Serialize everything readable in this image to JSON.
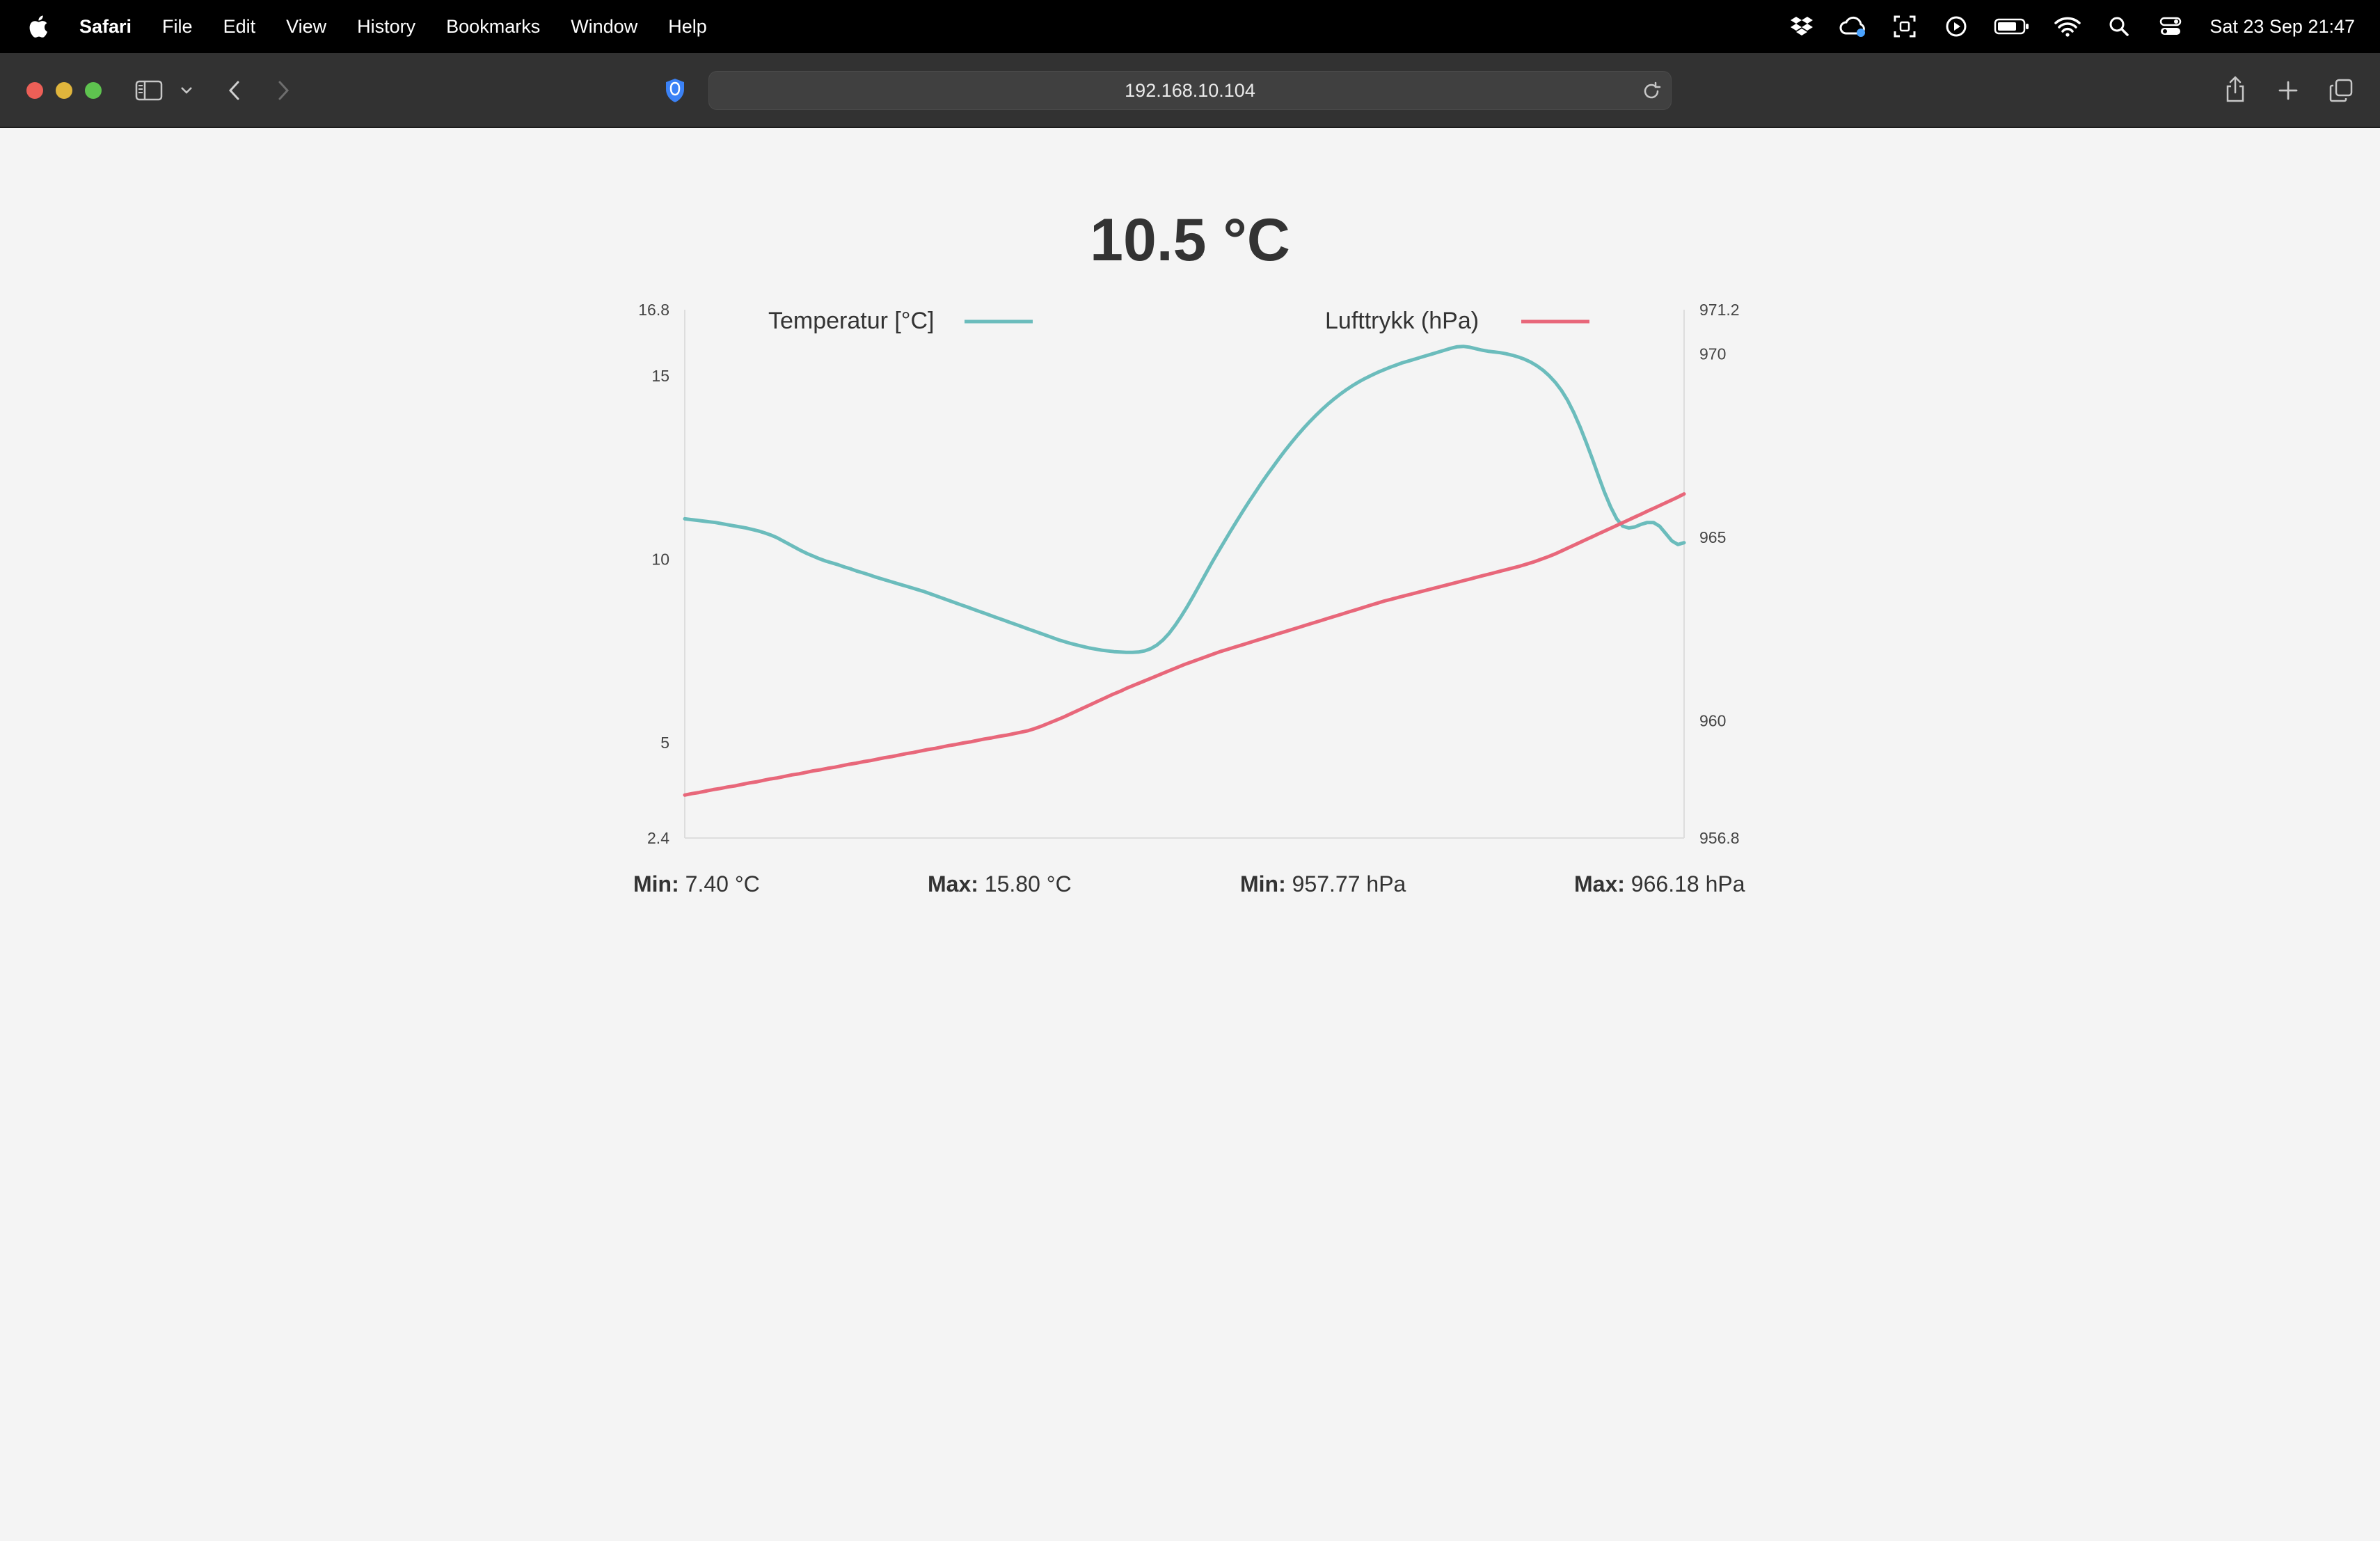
{
  "menubar": {
    "app_name": "Safari",
    "items": [
      "File",
      "Edit",
      "View",
      "History",
      "Bookmarks",
      "Window",
      "Help"
    ],
    "clock": "Sat 23 Sep  21:47",
    "status_icons": [
      "dropbox-icon",
      "cloud-sync-icon",
      "screen-capture-icon",
      "play-icon",
      "battery-icon",
      "wifi-icon",
      "search-icon",
      "control-center-icon"
    ]
  },
  "browser": {
    "url": "192.168.10.104"
  },
  "page": {
    "current_temperature": "10.5 °C",
    "stats": [
      {
        "label": "Min:",
        "value": " 7.40 °C"
      },
      {
        "label": "Max:",
        "value": " 15.80 °C"
      },
      {
        "label": "Min:",
        "value": " 957.77 hPa"
      },
      {
        "label": "Max:",
        "value": " 966.18 hPa"
      }
    ]
  },
  "colors": {
    "temperature": "#6bbcbc",
    "pressure": "#e8677a",
    "axis": "#dddddd",
    "text": "#333333"
  },
  "chart_data": {
    "type": "line",
    "grid": false,
    "legend_placement": "top",
    "x_points": 200,
    "series": [
      {
        "name": "Temperatur [°C]",
        "axis": "left",
        "values": [
          11.1,
          11.08,
          11.06,
          11.04,
          11.02,
          11.0,
          10.97,
          10.94,
          10.91,
          10.88,
          10.85,
          10.81,
          10.77,
          10.72,
          10.66,
          10.59,
          10.5,
          10.41,
          10.32,
          10.23,
          10.15,
          10.08,
          10.01,
          9.95,
          9.9,
          9.85,
          9.79,
          9.74,
          9.68,
          9.63,
          9.58,
          9.52,
          9.47,
          9.42,
          9.37,
          9.32,
          9.27,
          9.22,
          9.17,
          9.12,
          9.06,
          9.0,
          8.94,
          8.88,
          8.82,
          8.76,
          8.7,
          8.64,
          8.58,
          8.52,
          8.46,
          8.4,
          8.34,
          8.28,
          8.22,
          8.16,
          8.1,
          8.04,
          7.98,
          7.92,
          7.86,
          7.8,
          7.75,
          7.7,
          7.66,
          7.62,
          7.58,
          7.55,
          7.52,
          7.5,
          7.48,
          7.47,
          7.46,
          7.46,
          7.47,
          7.5,
          7.56,
          7.66,
          7.8,
          7.98,
          8.2,
          8.45,
          8.72,
          9.01,
          9.31,
          9.61,
          9.91,
          10.2,
          10.48,
          10.76,
          11.03,
          11.3,
          11.56,
          11.81,
          12.06,
          12.3,
          12.53,
          12.76,
          12.98,
          13.19,
          13.39,
          13.58,
          13.76,
          13.93,
          14.09,
          14.24,
          14.38,
          14.51,
          14.63,
          14.74,
          14.84,
          14.93,
          15.01,
          15.09,
          15.16,
          15.23,
          15.29,
          15.35,
          15.4,
          15.45,
          15.5,
          15.55,
          15.6,
          15.65,
          15.7,
          15.75,
          15.79,
          15.8,
          15.78,
          15.74,
          15.7,
          15.67,
          15.65,
          15.63,
          15.6,
          15.56,
          15.51,
          15.45,
          15.37,
          15.27,
          15.15,
          15.0,
          14.82,
          14.6,
          14.33,
          14.0,
          13.62,
          13.2,
          12.75,
          12.28,
          11.83,
          11.43,
          11.1,
          10.9,
          10.85,
          10.88,
          10.95,
          11.0,
          11.0,
          10.9,
          10.7,
          10.5,
          10.4,
          10.45
        ],
        "ylim": [
          2.4,
          16.8
        ],
        "ticks": [
          "16.8",
          "15",
          "10",
          "5",
          "2.4"
        ]
      },
      {
        "name": "Lufttrykk (hPa)",
        "axis": "right",
        "values": [
          957.97,
          958.01,
          958.04,
          958.08,
          958.12,
          958.15,
          958.19,
          958.22,
          958.26,
          958.3,
          958.33,
          958.37,
          958.41,
          958.44,
          958.48,
          958.52,
          958.55,
          958.59,
          958.63,
          958.66,
          958.7,
          958.73,
          958.77,
          958.81,
          958.84,
          958.88,
          958.91,
          958.95,
          958.99,
          959.02,
          959.06,
          959.1,
          959.13,
          959.17,
          959.21,
          959.24,
          959.28,
          959.32,
          959.35,
          959.39,
          959.42,
          959.46,
          959.5,
          959.53,
          959.57,
          959.6,
          959.64,
          959.68,
          959.72,
          959.78,
          959.85,
          959.93,
          960.01,
          960.09,
          960.18,
          960.27,
          960.36,
          960.45,
          960.54,
          960.63,
          960.72,
          960.8,
          960.89,
          960.97,
          961.05,
          961.13,
          961.21,
          961.29,
          961.37,
          961.45,
          961.53,
          961.6,
          961.67,
          961.74,
          961.81,
          961.88,
          961.94,
          962.0,
          962.06,
          962.12,
          962.18,
          962.24,
          962.3,
          962.36,
          962.42,
          962.48,
          962.54,
          962.6,
          962.66,
          962.72,
          962.78,
          962.84,
          962.9,
          962.96,
          963.02,
          963.08,
          963.14,
          963.2,
          963.26,
          963.31,
          963.36,
          963.41,
          963.46,
          963.51,
          963.56,
          963.61,
          963.66,
          963.71,
          963.76,
          963.81,
          963.86,
          963.91,
          963.96,
          964.01,
          964.06,
          964.11,
          964.16,
          964.21,
          964.27,
          964.33,
          964.4,
          964.47,
          964.55,
          964.64,
          964.73,
          964.82,
          964.91,
          965.0,
          965.09,
          965.18,
          965.27,
          965.36,
          965.45,
          965.54,
          965.63,
          965.72,
          965.81,
          965.9,
          965.99,
          966.08,
          966.18
        ],
        "ylim": [
          956.8,
          971.2
        ],
        "ticks": [
          "971.2",
          "970",
          "965",
          "960",
          "956.8"
        ]
      }
    ]
  }
}
